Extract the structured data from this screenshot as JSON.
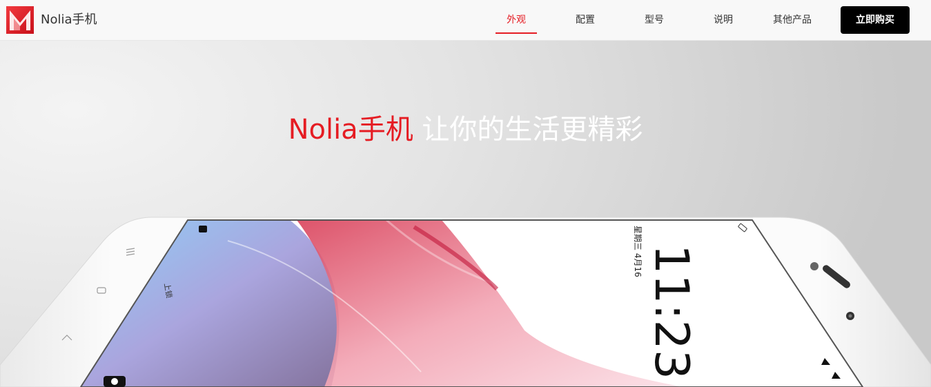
{
  "header": {
    "brand": "Nolia手机",
    "logo_icon": "m-logo-icon",
    "nav": [
      {
        "label": "外观",
        "active": true
      },
      {
        "label": "配置",
        "active": false
      },
      {
        "label": "型号",
        "active": false
      },
      {
        "label": "说明",
        "active": false
      },
      {
        "label": "其他产品",
        "active": false
      }
    ],
    "buy_label": "立即购买"
  },
  "hero": {
    "title_brand": "Nolia手机",
    "title_rest": " 让你的生活更精彩",
    "phone": {
      "time": "11:23",
      "date_text": "星期三 4月16",
      "side_text": "上锁"
    }
  },
  "colors": {
    "accent": "#e51c23",
    "buy_button": "#000000",
    "header_bg": "#f8f8f8"
  }
}
